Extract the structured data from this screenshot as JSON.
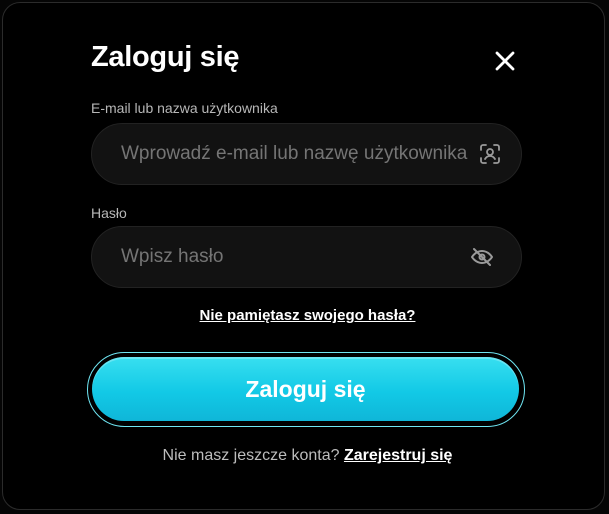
{
  "modal": {
    "title": "Zaloguj się"
  },
  "email": {
    "label": "E-mail lub nazwa użytkownika",
    "placeholder": "Wprowadź e-mail lub nazwę użytkownika",
    "value": ""
  },
  "password": {
    "label": "Hasło",
    "placeholder": "Wpisz hasło",
    "value": ""
  },
  "links": {
    "forgot_password": "Nie pamiętasz swojego hasła?"
  },
  "actions": {
    "login_label": "Zaloguj się"
  },
  "register": {
    "prompt": "Nie masz jeszcze konta?",
    "link_label": "Zarejestruj się"
  },
  "icons": {
    "close": "close-icon",
    "face_id": "face-id-icon",
    "hide_password": "eye-off-icon"
  },
  "colors": {
    "accent": "#12c9e6",
    "background": "#000000",
    "field_bg": "#121212"
  }
}
